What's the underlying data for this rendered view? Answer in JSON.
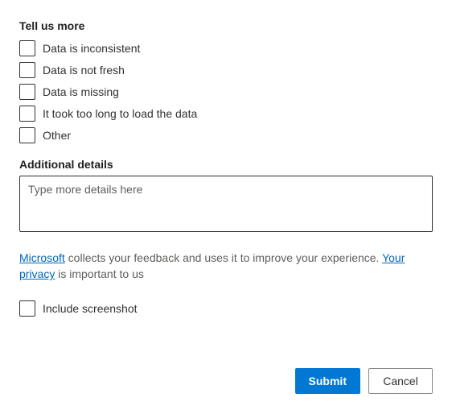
{
  "headings": {
    "tell_us_more": "Tell us more",
    "additional_details": "Additional details"
  },
  "options": {
    "inconsistent": "Data is inconsistent",
    "not_fresh": "Data is not fresh",
    "missing": "Data is missing",
    "too_long": "It took too long to load the data",
    "other": "Other"
  },
  "textarea": {
    "placeholder": "Type more details here"
  },
  "privacy": {
    "link1": "Microsoft",
    "text1": " collects your feedback and uses it to improve your experience. ",
    "link2": "Your privacy",
    "text2": " is important to us"
  },
  "screenshot": {
    "label": "Include screenshot"
  },
  "buttons": {
    "submit": "Submit",
    "cancel": "Cancel"
  }
}
